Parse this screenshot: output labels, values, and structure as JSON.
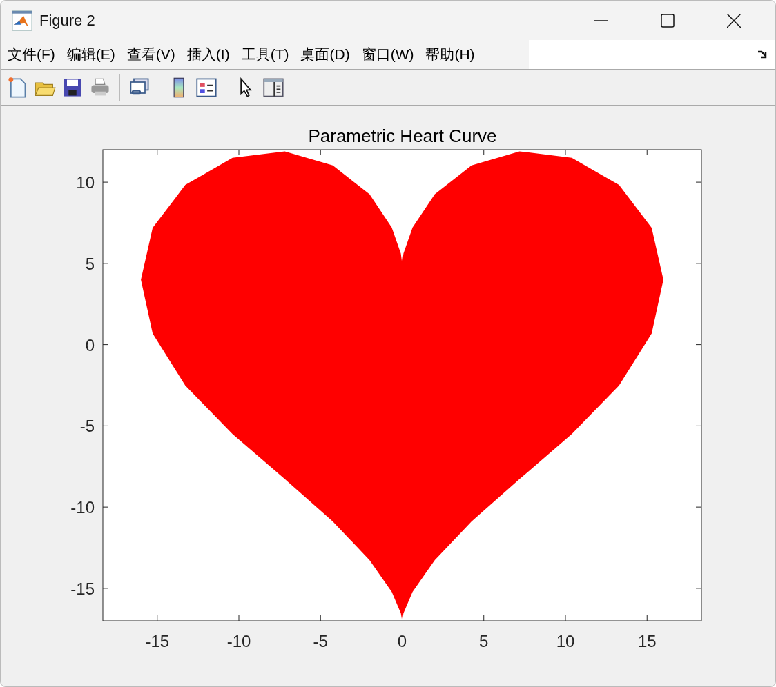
{
  "window": {
    "title": "Figure 2"
  },
  "menu": [
    "文件(F)",
    "编辑(E)",
    "查看(V)",
    "插入(I)",
    "工具(T)",
    "桌面(D)",
    "窗口(W)",
    "帮助(H)"
  ],
  "chart_data": {
    "type": "area",
    "title": "Parametric Heart Curve",
    "xlim": [
      -18.33,
      18.33
    ],
    "ylim": [
      -17,
      12
    ],
    "xticks": [
      -15,
      -10,
      -5,
      0,
      5,
      10,
      15
    ],
    "yticks": [
      -15,
      -10,
      -5,
      0,
      5,
      10
    ],
    "x": [
      0,
      0.08,
      0.64,
      2,
      4.25,
      7.19,
      10.39,
      13.28,
      15.28,
      16,
      15.28,
      13.28,
      10.39,
      7.19,
      4.25,
      2,
      0.64,
      0.08,
      0,
      -0.08,
      -0.64,
      -2,
      -4.25,
      -7.19,
      -10.39,
      -13.28,
      -15.28,
      -16,
      -15.28,
      -13.28,
      -10.39,
      -7.19,
      -4.25,
      -2,
      -0.64,
      -0.08
    ],
    "series": [
      {
        "color": "#ff0000",
        "values": [
          5,
          5.61,
          7.21,
          9.26,
          11.03,
          11.9,
          11.5,
          9.83,
          7.19,
          4,
          0.68,
          -2.52,
          -5.5,
          -8.28,
          -10.89,
          -13.26,
          -15.22,
          -16.53,
          -17,
          -16.53,
          -15.22,
          -13.26,
          -10.89,
          -8.28,
          -5.5,
          -2.52,
          0.68,
          4,
          7.19,
          9.83,
          11.5,
          11.9,
          11.03,
          9.26,
          7.21,
          5.61
        ]
      }
    ]
  }
}
